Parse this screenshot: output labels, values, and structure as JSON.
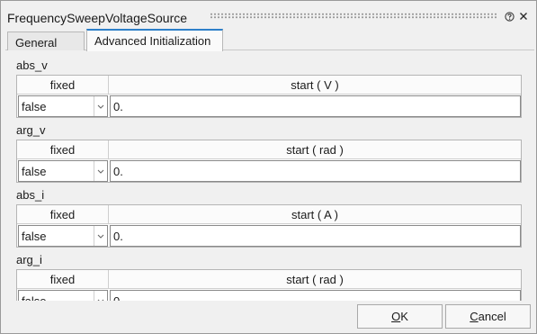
{
  "window": {
    "title": "FrequencySweepVoltageSource"
  },
  "tabs": [
    {
      "label": "General",
      "active": false
    },
    {
      "label": "Advanced Initialization",
      "active": true
    }
  ],
  "sections": [
    {
      "name": "abs_v",
      "fixed_header": "fixed",
      "start_header": "start ( V )",
      "fixed_value": "false",
      "start_value": "0."
    },
    {
      "name": "arg_v",
      "fixed_header": "fixed",
      "start_header": "start ( rad )",
      "fixed_value": "false",
      "start_value": "0."
    },
    {
      "name": "abs_i",
      "fixed_header": "fixed",
      "start_header": "start ( A )",
      "fixed_value": "false",
      "start_value": "0."
    },
    {
      "name": "arg_i",
      "fixed_header": "fixed",
      "start_header": "start ( rad )",
      "fixed_value": "false",
      "start_value": "0."
    }
  ],
  "buttons": {
    "ok": {
      "mnemonic": "O",
      "rest": "K"
    },
    "cancel": {
      "mnemonic": "C",
      "rest": "ancel"
    }
  },
  "icons": {
    "help": "help-icon",
    "close": "close-icon",
    "dropdown": "chevron-down-icon"
  },
  "colors": {
    "active_tab_accent": "#2d7fc9"
  }
}
